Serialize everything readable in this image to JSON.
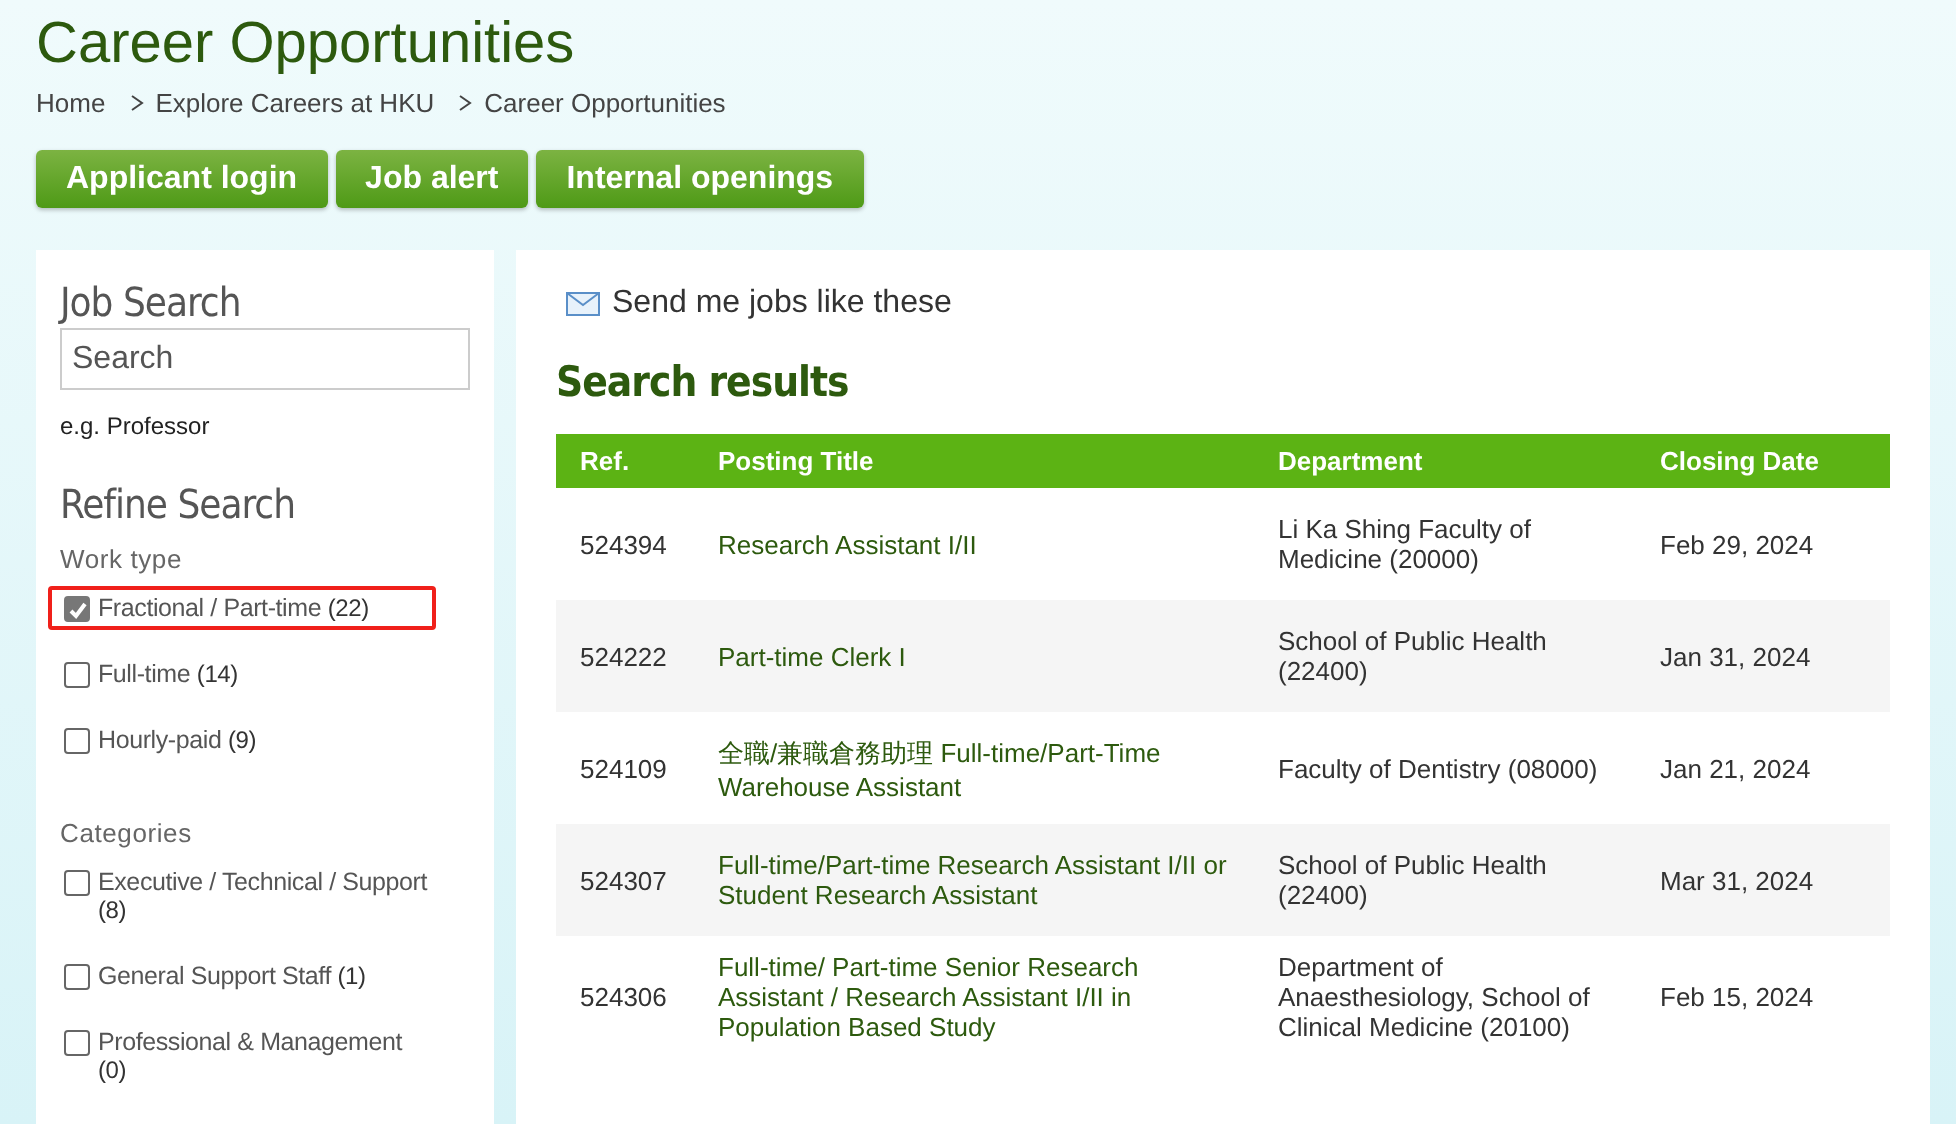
{
  "page_title": "Career Opportunities",
  "breadcrumb": [
    "Home",
    "Explore Careers at HKU",
    "Career Opportunities"
  ],
  "buttons": [
    "Applicant login",
    "Job alert",
    "Internal openings"
  ],
  "sidebar": {
    "title": "Job Search",
    "search": {
      "placeholder": "Search"
    },
    "hint": "e.g. Professor",
    "refine_title": "Refine Search",
    "groups": [
      {
        "label": "Work type",
        "options": [
          {
            "label": "Fractional / Part-time",
            "count": "(22)",
            "checked": true,
            "highlighted": true
          },
          {
            "label": "Full-time",
            "count": "(14)",
            "checked": false,
            "highlighted": false
          },
          {
            "label": "Hourly-paid",
            "count": "(9)",
            "checked": false,
            "highlighted": false
          }
        ]
      },
      {
        "label": "Categories",
        "options": [
          {
            "label": "Executive / Technical / Support",
            "count": "(8)",
            "checked": false,
            "highlighted": false
          },
          {
            "label": "General Support Staff",
            "count": "(1)",
            "checked": false,
            "highlighted": false
          },
          {
            "label": "Professional & Management",
            "count": "(0)",
            "checked": false,
            "highlighted": false
          }
        ]
      }
    ]
  },
  "main": {
    "send_link": "Send me jobs like these",
    "results_title": "Search results",
    "table": {
      "columns": [
        "Ref.",
        "Posting Title",
        "Department",
        "Closing Date"
      ],
      "rows": [
        {
          "ref": "524394",
          "title": "Research Assistant I/II",
          "department": "Li Ka Shing Faculty of Medicine (20000)",
          "closing": "Feb 29, 2024"
        },
        {
          "ref": "524222",
          "title": "Part-time Clerk I",
          "department": "School of Public Health (22400)",
          "closing": "Jan 31, 2024"
        },
        {
          "ref": "524109",
          "title": "全職/兼職倉務助理 Full-time/Part-Time Warehouse Assistant",
          "department": "Faculty of Dentistry (08000)",
          "closing": "Jan 21, 2024"
        },
        {
          "ref": "524307",
          "title": "Full-time/Part-time Research Assistant I/II or Student Research Assistant",
          "department": "School of Public Health (22400)",
          "closing": "Mar 31, 2024"
        },
        {
          "ref": "524306",
          "title": "Full-time/ Part-time Senior Research Assistant / Research Assistant I/II in Population Based Study",
          "department": "Department of Anaesthesiology, School of Clinical Medicine (20100)",
          "closing": "Feb 15, 2024"
        }
      ]
    }
  }
}
